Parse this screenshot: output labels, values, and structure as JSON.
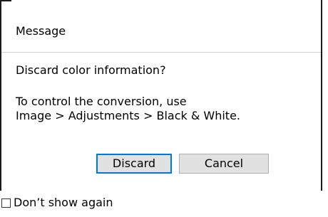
{
  "dialog": {
    "title": "Message",
    "question": "Discard color information?",
    "info_line1": "To control the conversion, use",
    "info_line2": "Image > Adjustments > Black & White.",
    "discard_label": "Discard",
    "cancel_label": "Cancel",
    "dont_show_label": "Don’t show again",
    "dont_show_checked": false,
    "default_button": "Discard"
  },
  "colors": {
    "background": "#ffffff",
    "button_face": "#e1e1e1",
    "button_border": "#adadad",
    "focus_border": "#0078d7"
  }
}
